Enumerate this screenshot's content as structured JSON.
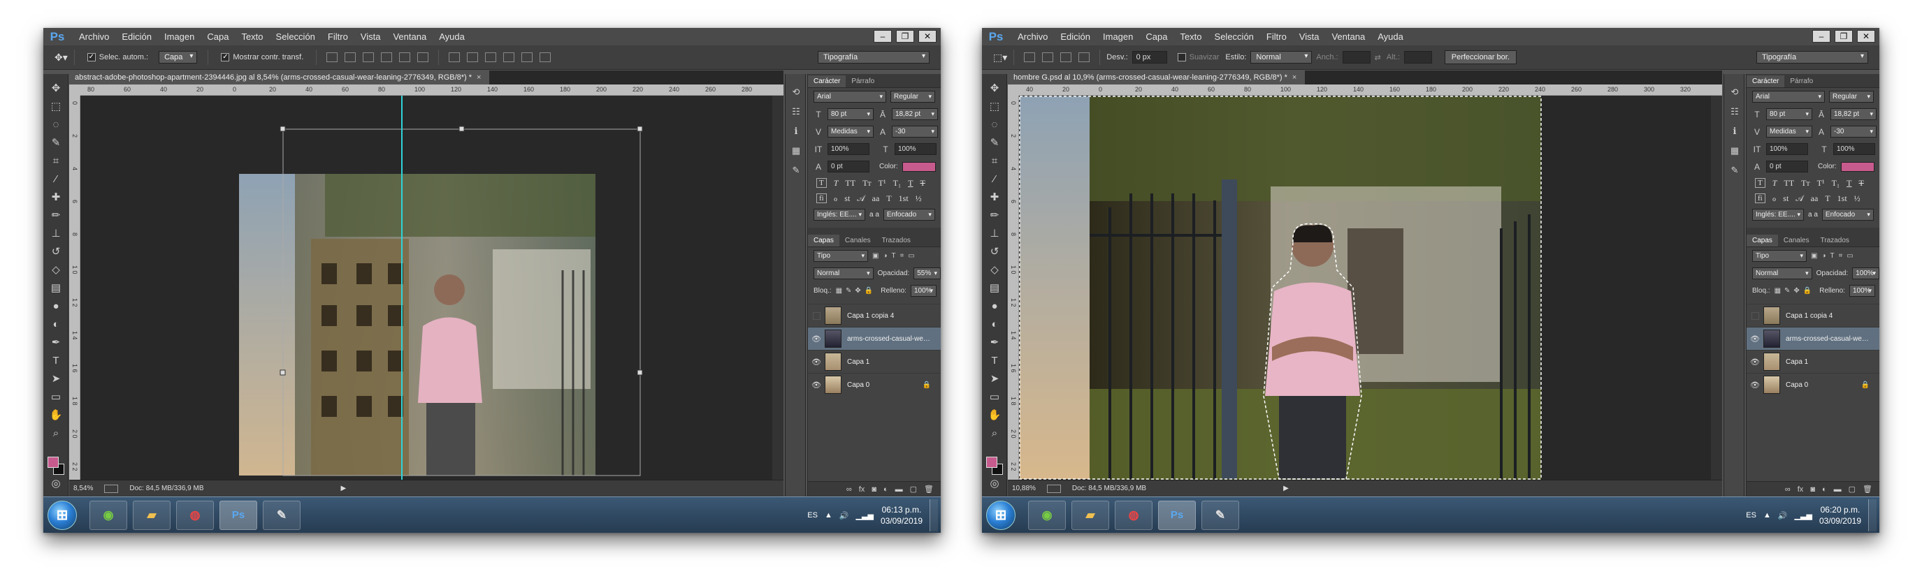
{
  "screens": [
    {
      "menu": [
        "Archivo",
        "Edición",
        "Imagen",
        "Capa",
        "Texto",
        "Selección",
        "Filtro",
        "Vista",
        "Ventana",
        "Ayuda"
      ],
      "options": {
        "auto_select_label": "Selec. autom.:",
        "auto_select_value": "Capa",
        "transform_label": "Mostrar contr. transf.",
        "workspace": "Tipografía"
      },
      "doc_tab": "abstract-adobe-photoshop-apartment-2394446.jpg al 8,54% (arms-crossed-casual-wear-leaning-2776349, RGB/8*) *",
      "ruler_h": [
        "80",
        "60",
        "40",
        "20",
        "0",
        "20",
        "40",
        "60",
        "80",
        "100",
        "120",
        "140",
        "160",
        "180",
        "200",
        "220",
        "240",
        "260",
        "280"
      ],
      "ruler_v": [
        "0",
        "2",
        "4",
        "6",
        "8",
        "1 0",
        "1 2",
        "1 4",
        "1 6",
        "1 8",
        "2 0",
        "2 2"
      ],
      "status": {
        "zoom": "8,54%",
        "doc": "Doc: 84,5 MB/336,9 MB"
      },
      "character": {
        "tab_active": "Carácter",
        "tab_other": "Párrafo",
        "font": "Arial",
        "style": "Regular",
        "size": "80 pt",
        "leading": "18,82 pt",
        "kerning": "Medidas",
        "tracking": "-30",
        "vscale": "100%",
        "hscale": "100%",
        "baseline": "0 pt",
        "color_label": "Color:",
        "color_hex": "#c85b8e",
        "language": "Inglés: EE....",
        "aa_label": "a a",
        "antialias": "Enfocado"
      },
      "layers_panel": {
        "tabs": [
          "Capas",
          "Canales",
          "Trazados"
        ],
        "filter": "Tipo",
        "blend": "Normal",
        "opacity_label": "Opacidad:",
        "opacity": "55%",
        "lock_label": "Bloq.:",
        "fill_label": "Relleno:",
        "fill": "100%",
        "layers": [
          {
            "name": "Capa 1 copia 4",
            "visible": false,
            "selected": false,
            "locked": false
          },
          {
            "name": "arms-crossed-casual-wear-leanin...",
            "visible": true,
            "selected": true,
            "locked": false
          },
          {
            "name": "Capa 1",
            "visible": true,
            "selected": false,
            "locked": false
          },
          {
            "name": "Capa 0",
            "visible": true,
            "selected": false,
            "locked": true
          }
        ]
      },
      "taskbar": {
        "lang": "ES",
        "time": "06:13 p.m.",
        "date": "03/09/2019"
      }
    },
    {
      "menu": [
        "Archivo",
        "Edición",
        "Imagen",
        "Capa",
        "Texto",
        "Selección",
        "Filtro",
        "Vista",
        "Ventana",
        "Ayuda"
      ],
      "options": {
        "feather_label": "Desv.:",
        "feather_value": "0 px",
        "smooth_label": "Suavizar",
        "style_label": "Estilo:",
        "style_value": "Normal",
        "width_label": "Anch.:",
        "height_label": "Alt.:",
        "refine_button": "Perfeccionar bor.",
        "workspace": "Tipografía"
      },
      "doc_tab": "hombre G.psd al 10,9% (arms-crossed-casual-wear-leaning-2776349, RGB/8*) *",
      "ruler_h": [
        "40",
        "20",
        "0",
        "20",
        "40",
        "60",
        "80",
        "100",
        "120",
        "140",
        "160",
        "180",
        "200",
        "220",
        "240",
        "260",
        "280",
        "300",
        "320"
      ],
      "ruler_v": [
        "0",
        "2",
        "4",
        "6",
        "8",
        "1 0",
        "1 2",
        "1 4",
        "1 6",
        "1 8",
        "2 0",
        "2 2"
      ],
      "status": {
        "zoom": "10,88%",
        "doc": "Doc: 84,5 MB/336,9 MB"
      },
      "character": {
        "tab_active": "Carácter",
        "tab_other": "Párrafo",
        "font": "Arial",
        "style": "Regular",
        "size": "80 pt",
        "leading": "18,82 pt",
        "kerning": "Medidas",
        "tracking": "-30",
        "vscale": "100%",
        "hscale": "100%",
        "baseline": "0 pt",
        "color_label": "Color:",
        "color_hex": "#c85b8e",
        "language": "Inglés: EE....",
        "aa_label": "a a",
        "antialias": "Enfocado"
      },
      "layers_panel": {
        "tabs": [
          "Capas",
          "Canales",
          "Trazados"
        ],
        "filter": "Tipo",
        "blend": "Normal",
        "opacity_label": "Opacidad:",
        "opacity": "100%",
        "lock_label": "Bloq.:",
        "fill_label": "Relleno:",
        "fill": "100%",
        "layers": [
          {
            "name": "Capa 1 copia 4",
            "visible": false,
            "selected": false,
            "locked": false
          },
          {
            "name": "arms-crossed-casual-wear-leanin...",
            "visible": true,
            "selected": true,
            "locked": false
          },
          {
            "name": "Capa 1",
            "visible": true,
            "selected": false,
            "locked": false
          },
          {
            "name": "Capa 0",
            "visible": true,
            "selected": false,
            "locked": true
          }
        ]
      },
      "taskbar": {
        "lang": "ES",
        "time": "06:20 p.m.",
        "date": "03/09/2019"
      }
    }
  ],
  "colors": {
    "accent_pink": "#c85b8e",
    "guide_cyan": "#2fd3d8",
    "selected_layer": "#607080"
  },
  "icons": [
    "photoshop-logo",
    "move-tool-icon",
    "marquee-tool-icon",
    "lasso-icon",
    "eye-icon",
    "lock-icon",
    "chrome-icon",
    "folder-icon",
    "start-orb"
  ]
}
